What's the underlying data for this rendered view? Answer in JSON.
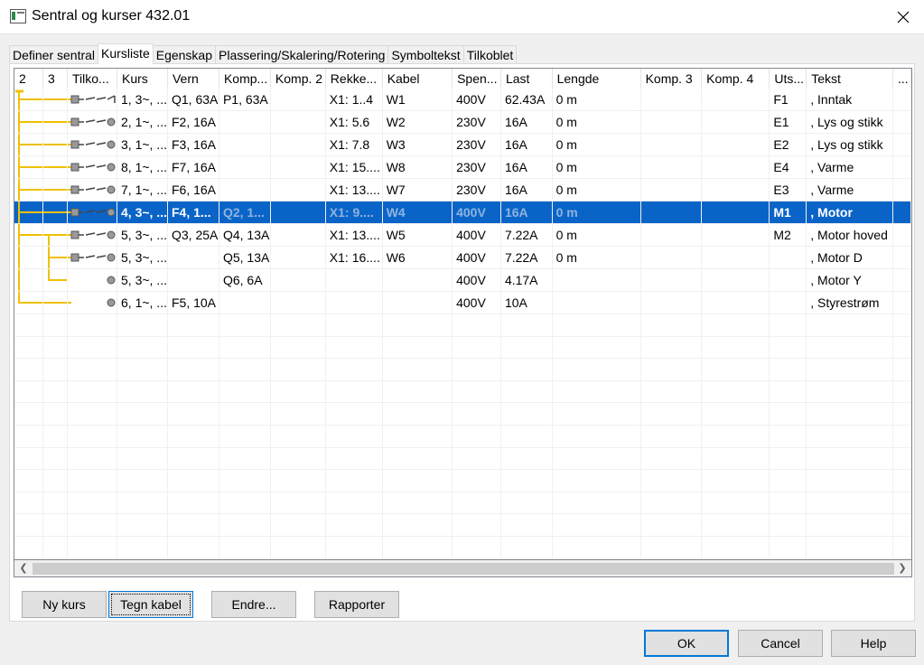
{
  "window": {
    "title": "Sentral og kurser  432.01"
  },
  "tabs": [
    "Definer sentral",
    "Kursliste",
    "Egenskap",
    "Plassering/Skalering/Rotering",
    "Symboltekst",
    "Tilkoblet"
  ],
  "columns": [
    "2",
    "3",
    "Tilko...",
    "Kurs",
    "Vern",
    "Komp...",
    "Komp. 2",
    "Rekke...",
    "Kabel",
    "Spen...",
    "Last",
    "Lengde",
    "Komp. 3",
    "Komp. 4",
    "Uts...",
    "Tekst",
    "..."
  ],
  "rows": [
    {
      "kurs": "1, 3~, ...",
      "vern": "Q1, 63A",
      "komp": "P1, 63A",
      "komp2": "",
      "rekke": "X1: 1..4",
      "kabel": "W1",
      "spen": "400V",
      "last": "62.43A",
      "lengde": "0 m",
      "komp3": "",
      "komp4": "",
      "uts": "F1",
      "tekst": ", Inntak"
    },
    {
      "kurs": "2, 1~, ...",
      "vern": "F2, 16A",
      "komp": "",
      "komp2": "",
      "rekke": "X1: 5.6",
      "kabel": "W2",
      "spen": "230V",
      "last": "16A",
      "lengde": "0 m",
      "komp3": "",
      "komp4": "",
      "uts": "E1",
      "tekst": ", Lys og stikk"
    },
    {
      "kurs": "3, 1~, ...",
      "vern": "F3, 16A",
      "komp": "",
      "komp2": "",
      "rekke": "X1: 7.8",
      "kabel": "W3",
      "spen": "230V",
      "last": "16A",
      "lengde": "0 m",
      "komp3": "",
      "komp4": "",
      "uts": "E2",
      "tekst": ", Lys og stikk"
    },
    {
      "kurs": "8, 1~, ...",
      "vern": "F7, 16A",
      "komp": "",
      "komp2": "",
      "rekke": "X1: 15....",
      "kabel": "W8",
      "spen": "230V",
      "last": "16A",
      "lengde": "0 m",
      "komp3": "",
      "komp4": "",
      "uts": "E4",
      "tekst": ", Varme"
    },
    {
      "kurs": "7, 1~, ...",
      "vern": "F6, 16A",
      "komp": "",
      "komp2": "",
      "rekke": "X1: 13....",
      "kabel": "W7",
      "spen": "230V",
      "last": "16A",
      "lengde": "0 m",
      "komp3": "",
      "komp4": "",
      "uts": "E3",
      "tekst": ", Varme"
    },
    {
      "kurs": "4, 3~, ...",
      "vern": "F4, 1...",
      "komp": "Q2, 1...",
      "komp2": "",
      "rekke": "X1: 9....",
      "kabel": "W4",
      "spen": "400V",
      "last": "16A",
      "lengde": "0 m",
      "komp3": "",
      "komp4": "",
      "uts": "M1",
      "tekst": ", Motor"
    },
    {
      "kurs": "5, 3~, ...",
      "vern": "Q3, 25A",
      "komp": "Q4, 13A",
      "komp2": "",
      "rekke": "X1: 13....",
      "kabel": "W5",
      "spen": "400V",
      "last": "7.22A",
      "lengde": "0 m",
      "komp3": "",
      "komp4": "",
      "uts": "M2",
      "tekst": ", Motor hoved"
    },
    {
      "kurs": "5, 3~, ...",
      "vern": "",
      "komp": "Q5, 13A",
      "komp2": "",
      "rekke": "X1: 16....",
      "kabel": "W6",
      "spen": "400V",
      "last": "7.22A",
      "lengde": "0 m",
      "komp3": "",
      "komp4": "",
      "uts": "",
      "tekst": ", Motor D"
    },
    {
      "kurs": "5, 3~, ...",
      "vern": "",
      "komp": "Q6, 6A",
      "komp2": "",
      "rekke": "",
      "kabel": "",
      "spen": "400V",
      "last": "4.17A",
      "lengde": "",
      "komp3": "",
      "komp4": "",
      "uts": "",
      "tekst": ", Motor Y"
    },
    {
      "kurs": "6, 1~, ...",
      "vern": "F5, 10A",
      "komp": "",
      "komp2": "",
      "rekke": "",
      "kabel": "",
      "spen": "400V",
      "last": "10A",
      "lengde": "",
      "komp3": "",
      "komp4": "",
      "uts": "",
      "tekst": ", Styrestrøm"
    }
  ],
  "selected_row": 5,
  "panel_buttons": {
    "new": "Ny kurs",
    "draw": "Tegn kabel",
    "edit": "Endre...",
    "report": "Rapporter"
  },
  "dialog_buttons": {
    "ok": "OK",
    "cancel": "Cancel",
    "help": "Help"
  },
  "colors": {
    "selection": "#0a64c8",
    "tree_line": "#f0c000",
    "accent": "#0078d7"
  },
  "icons": {
    "close": "close-icon",
    "app": "app-icon",
    "scroll_left": "chevron-left-icon",
    "scroll_right": "chevron-right-icon"
  }
}
